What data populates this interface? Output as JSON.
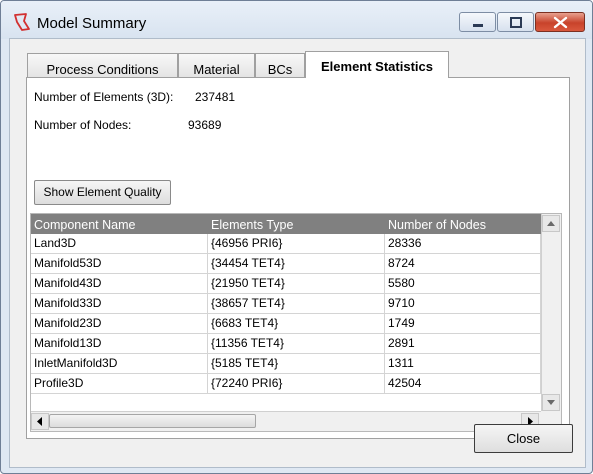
{
  "window": {
    "title": "Model Summary"
  },
  "tabs": [
    {
      "label": "Process Conditions"
    },
    {
      "label": "Material"
    },
    {
      "label": "BCs"
    },
    {
      "label": "Element Statistics",
      "active": true
    }
  ],
  "stats": {
    "elements_label": "Number of Elements (3D):",
    "elements_value": "237481",
    "nodes_label": "Number of Nodes:",
    "nodes_value": "93689"
  },
  "quality_button": "Show Element Quality",
  "table": {
    "headers": [
      "Component Name",
      "Elements Type",
      "Number of Nodes"
    ],
    "rows": [
      [
        "Land3D",
        "{46956 PRI6}",
        "28336"
      ],
      [
        "Manifold53D",
        "{34454 TET4}",
        "8724"
      ],
      [
        "Manifold43D",
        "{21950 TET4}",
        "5580"
      ],
      [
        "Manifold33D",
        "{38657 TET4}",
        "9710"
      ],
      [
        "Manifold23D",
        "{6683 TET4}",
        "1749"
      ],
      [
        "Manifold13D",
        "{11356 TET4}",
        "2891"
      ],
      [
        "InletManifold3D",
        "{5185 TET4}",
        "1311"
      ],
      [
        "Profile3D",
        "{72240 PRI6}",
        "42504"
      ]
    ]
  },
  "close_button": "Close",
  "icons": {
    "app": "model-app-icon",
    "minimize": "minimize-icon",
    "maximize": "maximize-icon",
    "close": "close-icon"
  },
  "colors": {
    "header_bg": "#808080",
    "close_btn": "#c8432b",
    "app_icon": "#d23030"
  }
}
